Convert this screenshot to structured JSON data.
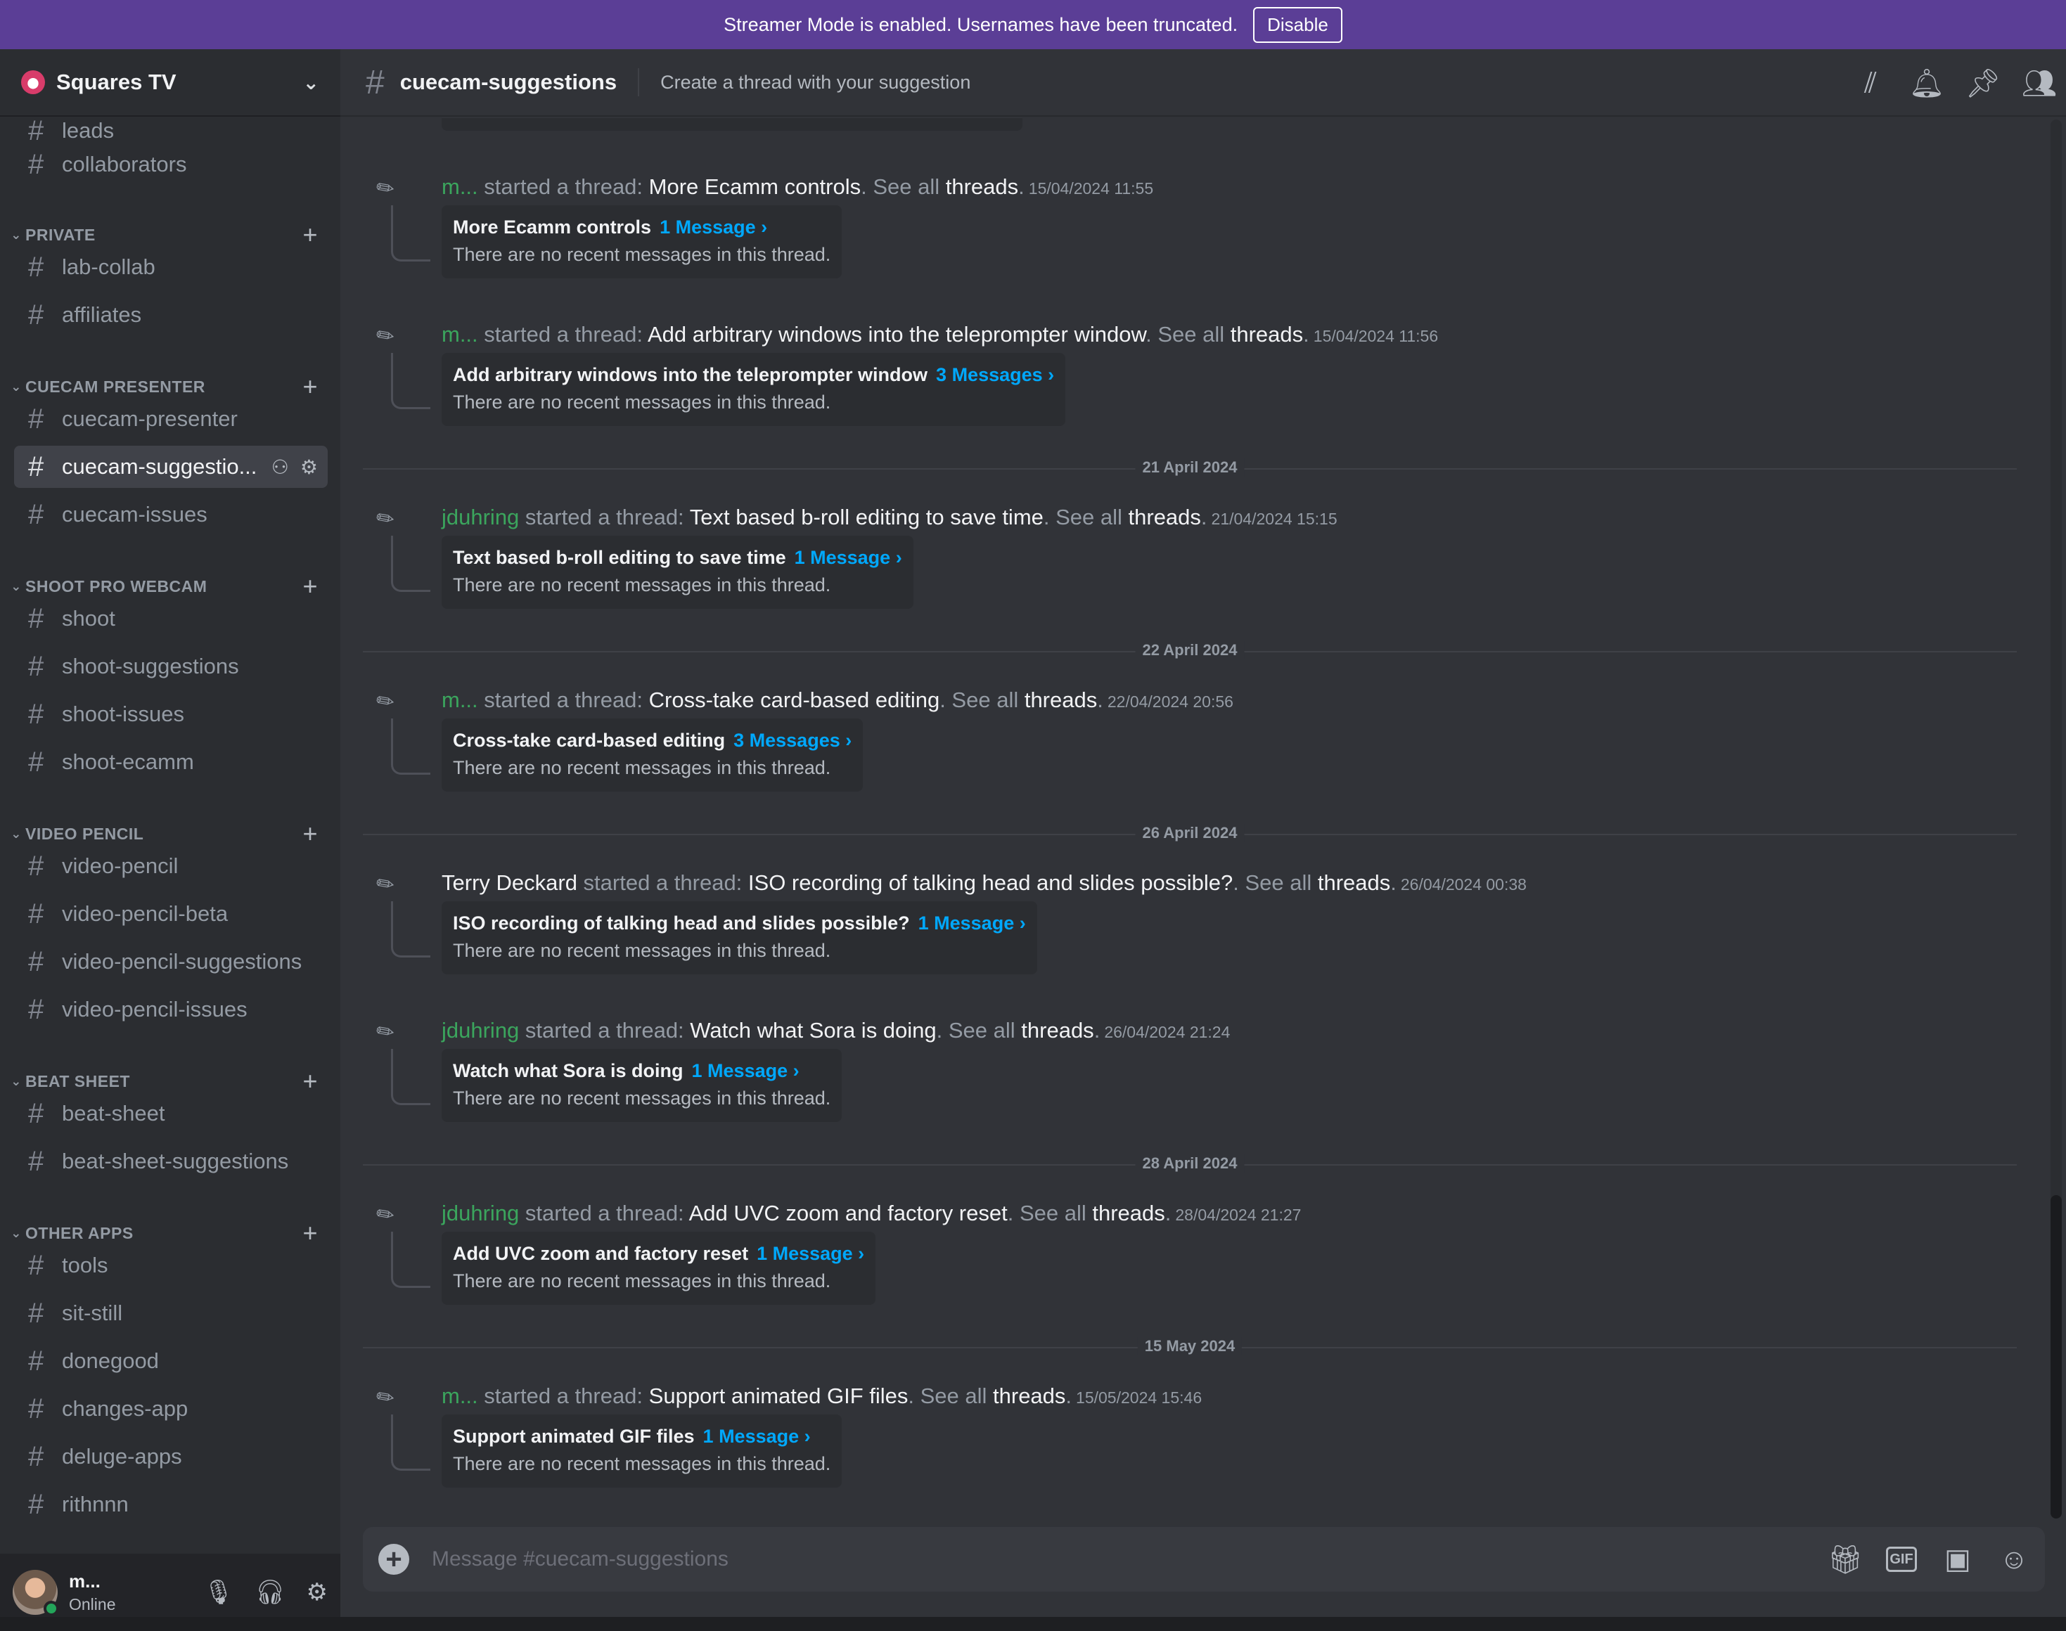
{
  "banner": {
    "text": "Streamer Mode is enabled. Usernames have been truncated.",
    "button": "Disable"
  },
  "server": {
    "name": "Squares TV"
  },
  "sidebar": {
    "channels_top": [
      {
        "label": "leads"
      },
      {
        "label": "collaborators"
      }
    ],
    "categories": [
      {
        "label": "PRIVATE",
        "channels": [
          "lab-collab",
          "affiliates"
        ]
      },
      {
        "label": "CUECAM PRESENTER",
        "channels": [
          "cuecam-presenter",
          "cuecam-suggestio...",
          "cuecam-issues"
        ]
      },
      {
        "label": "SHOOT PRO WEBCAM",
        "channels": [
          "shoot",
          "shoot-suggestions",
          "shoot-issues",
          "shoot-ecamm"
        ]
      },
      {
        "label": "VIDEO PENCIL",
        "channels": [
          "video-pencil",
          "video-pencil-beta",
          "video-pencil-suggestions",
          "video-pencil-issues"
        ]
      },
      {
        "label": "BEAT SHEET",
        "channels": [
          "beat-sheet",
          "beat-sheet-suggestions"
        ]
      },
      {
        "label": "OTHER APPS",
        "channels": [
          "tools",
          "sit-still",
          "donegood",
          "changes-app",
          "deluge-apps",
          "rithnnn"
        ]
      }
    ]
  },
  "user": {
    "name": "m...",
    "status": "Online"
  },
  "channel": {
    "name": "cuecam-suggestions",
    "topic": "Create a thread with your suggestion"
  },
  "strings": {
    "started": " started a thread: ",
    "see_all": ". See all ",
    "threads": "threads",
    "dot": ".",
    "no_recent": "There are no recent messages in this thread."
  },
  "days": [
    "21 April 2024",
    "22 April 2024",
    "26 April 2024",
    "28 April 2024",
    "15 May 2024"
  ],
  "threads": [
    {
      "author": "m...",
      "title": "More Ecamm controls",
      "timestamp": "15/04/2024 11:55",
      "count": "1 Message ›"
    },
    {
      "author": "m...",
      "title": "Add arbitrary windows into the teleprompter window",
      "timestamp": "15/04/2024 11:56",
      "count": "3 Messages ›"
    },
    {
      "author": "jduhring",
      "title": "Text based b-roll editing to save time",
      "timestamp": "21/04/2024 15:15",
      "count": "1 Message ›"
    },
    {
      "author": "m...",
      "title": "Cross-take card-based editing",
      "timestamp": "22/04/2024 20:56",
      "count": "3 Messages ›"
    },
    {
      "author": "Terry Deckard",
      "title": "ISO recording of talking head and slides possible?",
      "timestamp": "26/04/2024 00:38",
      "count": "1 Message ›"
    },
    {
      "author": "jduhring",
      "title": "Watch what Sora is doing",
      "timestamp": "26/04/2024 21:24",
      "count": "1 Message ›"
    },
    {
      "author": "jduhring",
      "title": "Add UVC zoom and factory reset",
      "timestamp": "28/04/2024 21:27",
      "count": "1 Message ›"
    },
    {
      "author": "m...",
      "title": "Support animated GIF files",
      "timestamp": "15/05/2024 15:46",
      "count": "1 Message ›"
    }
  ],
  "composer": {
    "placeholder": "Message #cuecam-suggestions",
    "gif": "GIF"
  },
  "colors": {
    "banner": "#5b3e96",
    "author_green": "#3ba55d",
    "link_blue": "#00a8fc"
  }
}
